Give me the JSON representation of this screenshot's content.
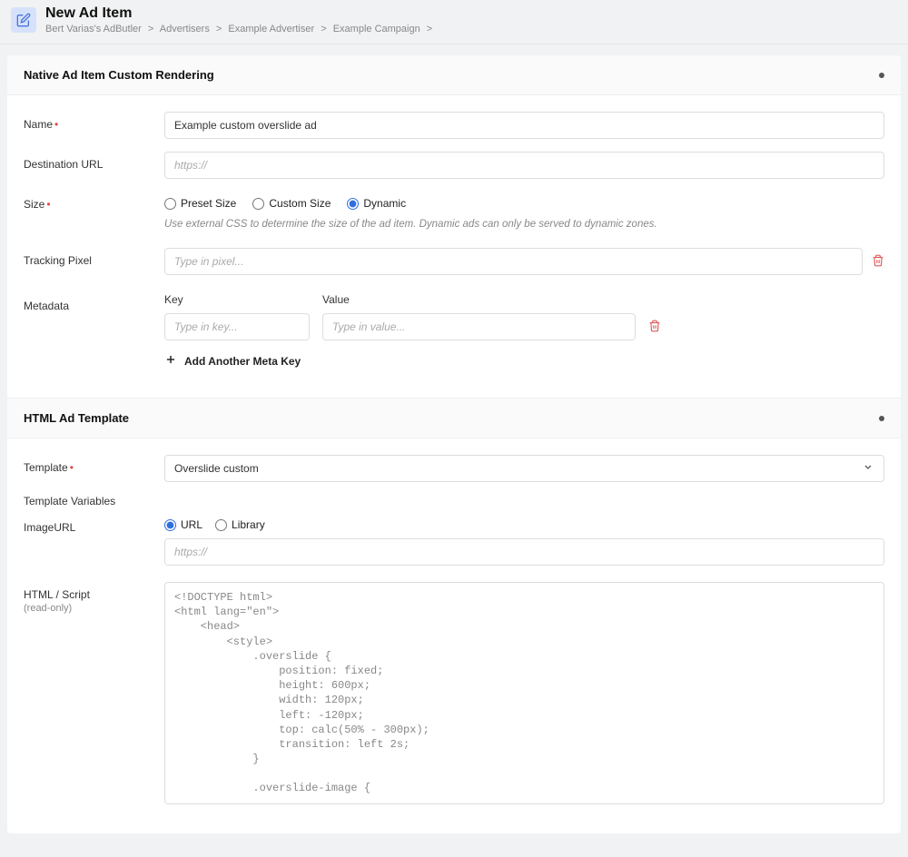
{
  "header": {
    "title": "New Ad Item",
    "breadcrumb": [
      "Bert Varias's AdButler",
      "Advertisers",
      "Example Advertiser",
      "Example Campaign"
    ]
  },
  "section1": {
    "title": "Native Ad Item Custom Rendering",
    "name_label": "Name",
    "name_value": "Example custom overslide ad",
    "dest_label": "Destination URL",
    "dest_placeholder": "https://",
    "size_label": "Size",
    "size_options": {
      "preset": "Preset Size",
      "custom": "Custom Size",
      "dynamic": "Dynamic"
    },
    "size_hint": "Use external CSS to determine the size of the ad item. Dynamic ads can only be served to dynamic zones.",
    "tracking_label": "Tracking Pixel",
    "tracking_placeholder": "Type in pixel...",
    "metadata_label": "Metadata",
    "meta_key_label": "Key",
    "meta_value_label": "Value",
    "meta_key_placeholder": "Type in key...",
    "meta_value_placeholder": "Type in value...",
    "add_meta_label": "Add Another Meta Key"
  },
  "section2": {
    "title": "HTML Ad Template",
    "template_label": "Template",
    "template_value": "Overslide custom",
    "template_vars_label": "Template Variables",
    "imageurl_label": "ImageURL",
    "url_option": "URL",
    "library_option": "Library",
    "imageurl_placeholder": "https://",
    "html_label": "HTML / Script",
    "html_sub": "(read-only)",
    "code": "<!DOCTYPE html>\n<html lang=\"en\">\n    <head>\n        <style>\n            .overslide {\n                position: fixed;\n                height: 600px;\n                width: 120px;\n                left: -120px;\n                top: calc(50% - 300px);\n                transition: left 2s;\n            }\n\n            .overslide-image {"
  }
}
